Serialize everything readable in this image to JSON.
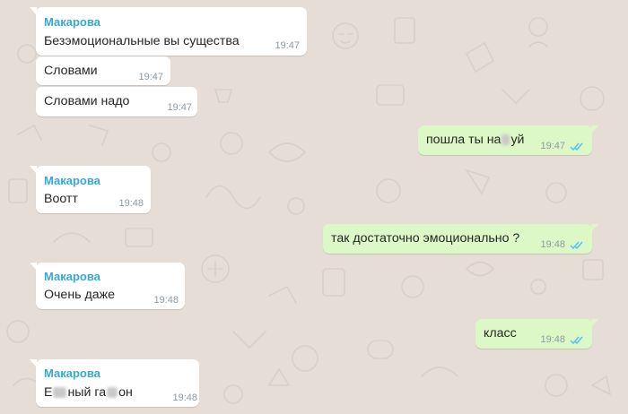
{
  "chat": {
    "messages": [
      {
        "sender": "Макарова",
        "text": "Безэмоциональные вы существа",
        "time": "19:47"
      },
      {
        "text": "Словами",
        "time": "19:47"
      },
      {
        "text": "Словами надо",
        "time": "19:47"
      },
      {
        "text_before": "пошла ты на",
        "text_after": "уй",
        "time": "19:47",
        "status_icon": "double-check-icon"
      },
      {
        "sender": "Макарова",
        "text": "Воотт",
        "time": "19:48"
      },
      {
        "text": "так достаточно эмоционально ?",
        "time": "19:48",
        "status_icon": "double-check-icon"
      },
      {
        "sender": "Макарова",
        "text": "Очень даже",
        "time": "19:48"
      },
      {
        "text": "класс",
        "time": "19:48",
        "status_icon": "double-check-icon"
      },
      {
        "sender": "Макарова",
        "text_part1": "Е",
        "text_part2": "ный га",
        "text_part3": "он",
        "time": "19:48"
      }
    ]
  },
  "colors": {
    "background": "#e6ded6",
    "incoming_bubble": "#ffffff",
    "outgoing_bubble": "#dcf8c6",
    "sender_name": "#35a9d6",
    "read_ticks": "#4fc3f7"
  }
}
